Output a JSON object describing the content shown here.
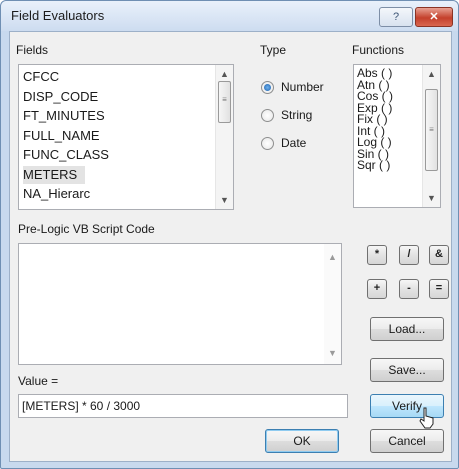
{
  "window": {
    "title": "Field Evaluators",
    "help_label": "?",
    "close_label": "✕"
  },
  "fields": {
    "label": "Fields",
    "items": [
      "CFCC",
      "DISP_CODE",
      "FT_MINUTES",
      "FULL_NAME",
      "FUNC_CLASS",
      "METERS",
      "NA_Hierarc"
    ],
    "selected": "METERS"
  },
  "type": {
    "label": "Type",
    "options": [
      "Number",
      "String",
      "Date"
    ],
    "selected": "Number"
  },
  "functions": {
    "label": "Functions",
    "items": [
      "Abs ( )",
      "Atn ( )",
      "Cos ( )",
      "Exp ( )",
      "Fix ( )",
      "Int ( )",
      "Log ( )",
      "Sin ( )",
      "Sqr ( )"
    ]
  },
  "prelogic": {
    "label": "Pre-Logic VB Script Code",
    "value": ""
  },
  "operators": [
    "*",
    "/",
    "&",
    "+",
    "-",
    "="
  ],
  "value_expr": {
    "label": "Value =",
    "value": "[METERS] * 60 / 3000"
  },
  "buttons": {
    "load": "Load...",
    "save": "Save...",
    "verify": "Verify",
    "ok": "OK",
    "cancel": "Cancel"
  },
  "colors": {
    "titlebar": "#cddcf0",
    "close_button": "#c4402c",
    "hover_button": "#bee6fd"
  }
}
